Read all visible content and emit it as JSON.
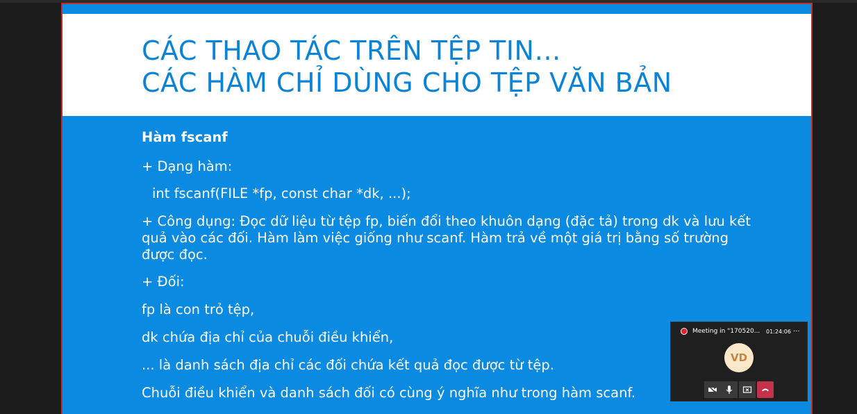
{
  "slide": {
    "title_lines": [
      "CÁC THAO TÁC TRÊN TỆP TIN…",
      "CÁC HÀM CHỈ DÙNG CHO TỆP VĂN BẢN"
    ],
    "heading": "Hàm fscanf",
    "syntax_label": "+ Dạng hàm:",
    "syntax": "int fscanf(FILE *fp, const char *dk, ...);",
    "usage": "+ Công dụng: Đọc dữ liệu từ tệp fp, biến đổi theo khuôn dạng (đặc tả) trong dk và lưu kết quả vào các đối. Hàm làm việc giống như scanf. Hàm trả về một giá trị bằng số trường được đọc.",
    "args_label": "+ Đối:",
    "args": [
      "fp là con trỏ tệp,",
      "dk chứa địa chỉ của chuỗi điều khiển,",
      "... là danh sách địa chỉ các đối chứa kết quả đọc được từ tệp.",
      "Chuỗi điều khiển và danh sách đối có cùng ý nghĩa như trong hàm scanf."
    ]
  },
  "meeting": {
    "title": "Meeting in \"170520...",
    "time": "01:24:06",
    "more": "...",
    "avatar_initials": "VD",
    "controls": [
      "camera-off-icon",
      "microphone-icon",
      "share-screen-icon",
      "hangup-icon"
    ]
  },
  "colors": {
    "slide_blue": "#0a8ae0",
    "title_blue": "#0a84d6",
    "slide_border": "#c0302b",
    "hangup_red": "#c4314b",
    "avatar_bg": "#fbe7c9",
    "avatar_text": "#c4873b"
  }
}
